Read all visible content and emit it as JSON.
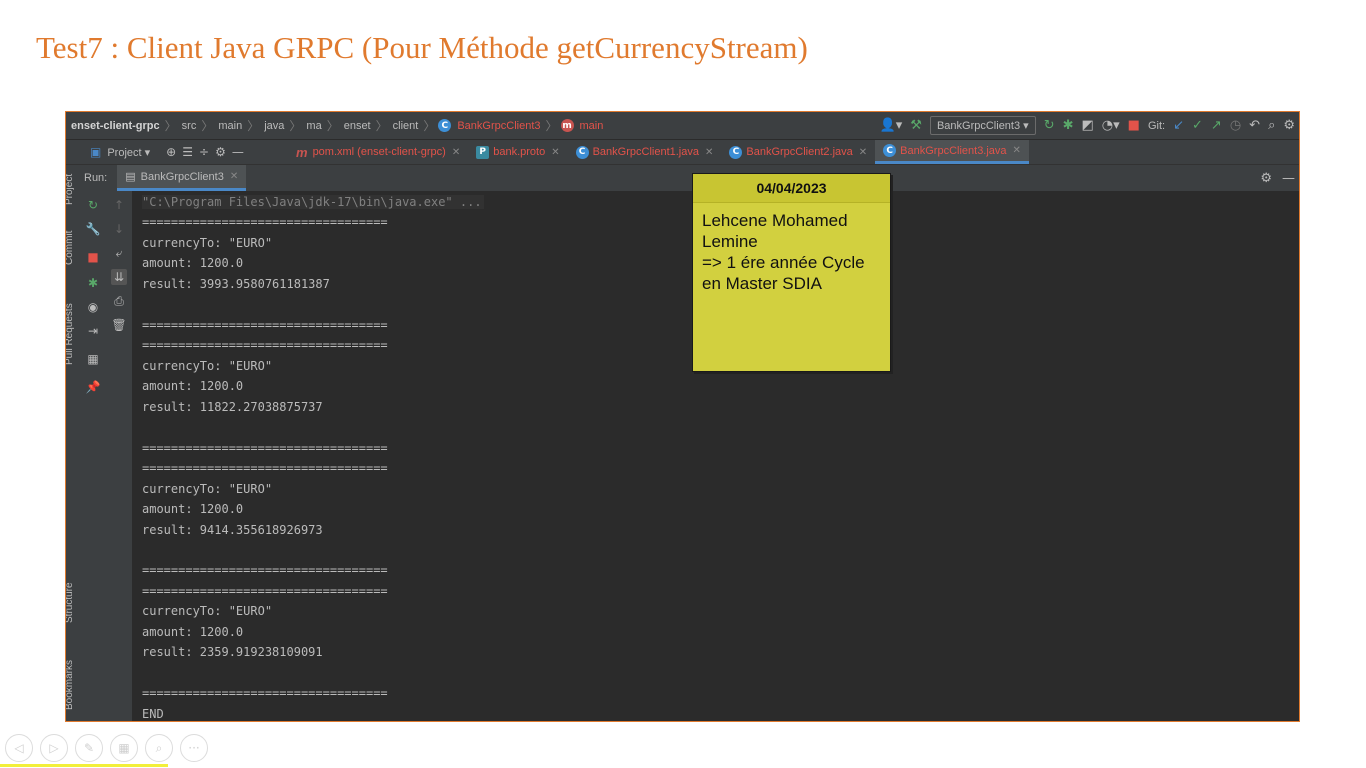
{
  "slide": {
    "title": "Test7 : Client Java GRPC (Pour Méthode getCurrencyStream)"
  },
  "breadcrumb": [
    "enset-client-grpc",
    "src",
    "main",
    "java",
    "ma",
    "enset",
    "client",
    "BankGrpcClient3",
    "main"
  ],
  "toolbar": {
    "run_config": "BankGrpcClient3",
    "git_label": "Git:"
  },
  "project_tool": {
    "label": "Project"
  },
  "tabs": [
    {
      "label": "pom.xml (enset-client-grpc)",
      "icon": "m"
    },
    {
      "label": "bank.proto",
      "icon": "P"
    },
    {
      "label": "BankGrpcClient1.java",
      "icon": "C"
    },
    {
      "label": "BankGrpcClient2.java",
      "icon": "C"
    },
    {
      "label": "BankGrpcClient3.java",
      "icon": "C",
      "active": true
    }
  ],
  "side_labels": {
    "project": "Project",
    "commit": "Commit",
    "pull_requests": "Pull Requests",
    "structure": "Structure",
    "bookmarks": "Bookmarks"
  },
  "run_panel": {
    "label": "Run:",
    "tab": "BankGrpcClient3"
  },
  "console_lines": [
    "\"C:\\Program Files\\Java\\jdk-17\\bin\\java.exe\" ...",
    "==================================",
    "currencyTo: \"EURO\"",
    "amount: 1200.0",
    "result: 3993.9580761181387",
    "",
    "==================================",
    "==================================",
    "currencyTo: \"EURO\"",
    "amount: 1200.0",
    "result: 11822.27038875737",
    "",
    "==================================",
    "==================================",
    "currencyTo: \"EURO\"",
    "amount: 1200.0",
    "result: 9414.355618926973",
    "",
    "==================================",
    "==================================",
    "currencyTo: \"EURO\"",
    "amount: 1200.0",
    "result: 2359.919238109091",
    "",
    "==================================",
    "END"
  ],
  "sticky_note": {
    "date": "04/04/2023",
    "lines": [
      "Lehcene Mohamed",
      "Lemine",
      "=> 1 ére année Cycle",
      "en Master SDIA"
    ]
  },
  "colors": {
    "title": "#e07a2e",
    "ide_bg": "#2b2b2b",
    "panel_bg": "#3c3f41",
    "note_bg": "#d2d03f",
    "tab_text": "#e2534a",
    "accent_blue": "#4a88c7"
  }
}
